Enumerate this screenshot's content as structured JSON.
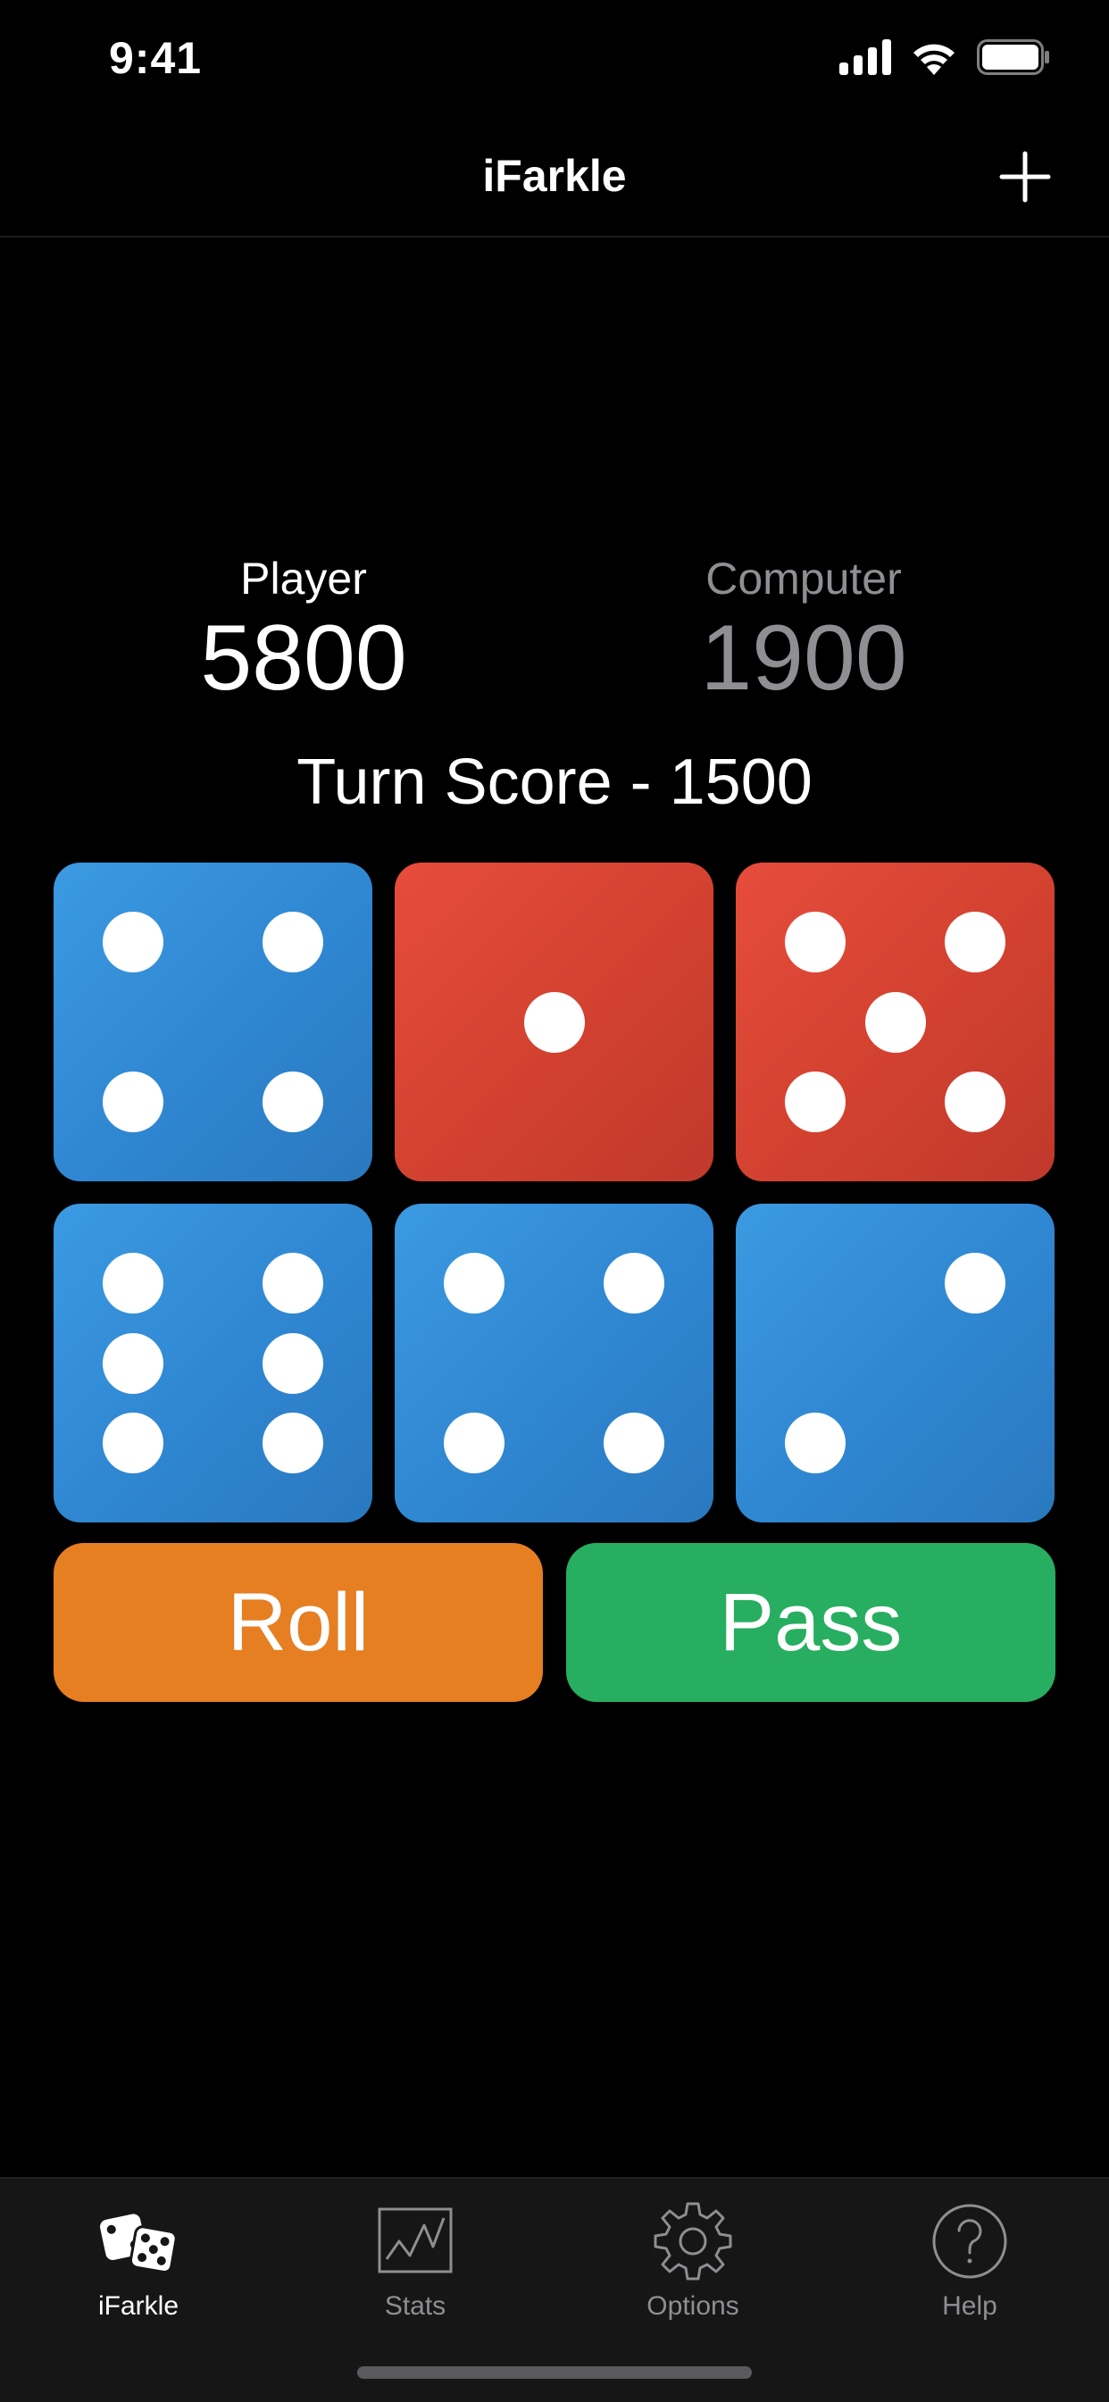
{
  "status_bar": {
    "time": "9:41",
    "icons": [
      "cellular-signal-icon",
      "wifi-icon",
      "battery-icon"
    ]
  },
  "nav": {
    "title": "iFarkle",
    "add_icon": "plus-icon"
  },
  "scores": {
    "player": {
      "label": "Player",
      "value": "5800"
    },
    "computer": {
      "label": "Computer",
      "value": "1900"
    }
  },
  "turn_score": "Turn Score - 1500",
  "dice": [
    {
      "value": 4,
      "color": "blue",
      "state": "unheld"
    },
    {
      "value": 1,
      "color": "red",
      "state": "held"
    },
    {
      "value": 5,
      "color": "red",
      "state": "held"
    },
    {
      "value": 6,
      "color": "blue",
      "state": "unheld"
    },
    {
      "value": 4,
      "color": "blue",
      "state": "unheld"
    },
    {
      "value": 2,
      "color": "blue",
      "state": "unheld"
    }
  ],
  "colors": {
    "die_blue": "#3b9ae1",
    "die_red": "#e74c3c",
    "roll_button": "#e67e22",
    "pass_button": "#27ae60",
    "secondary_text": "#8e8e93"
  },
  "actions": {
    "roll_label": "Roll",
    "pass_label": "Pass"
  },
  "tabs": [
    {
      "label": "iFarkle",
      "icon": "dice-icon",
      "active": true
    },
    {
      "label": "Stats",
      "icon": "chart-icon",
      "active": false
    },
    {
      "label": "Options",
      "icon": "gear-icon",
      "active": false
    },
    {
      "label": "Help",
      "icon": "help-circle-icon",
      "active": false
    }
  ]
}
